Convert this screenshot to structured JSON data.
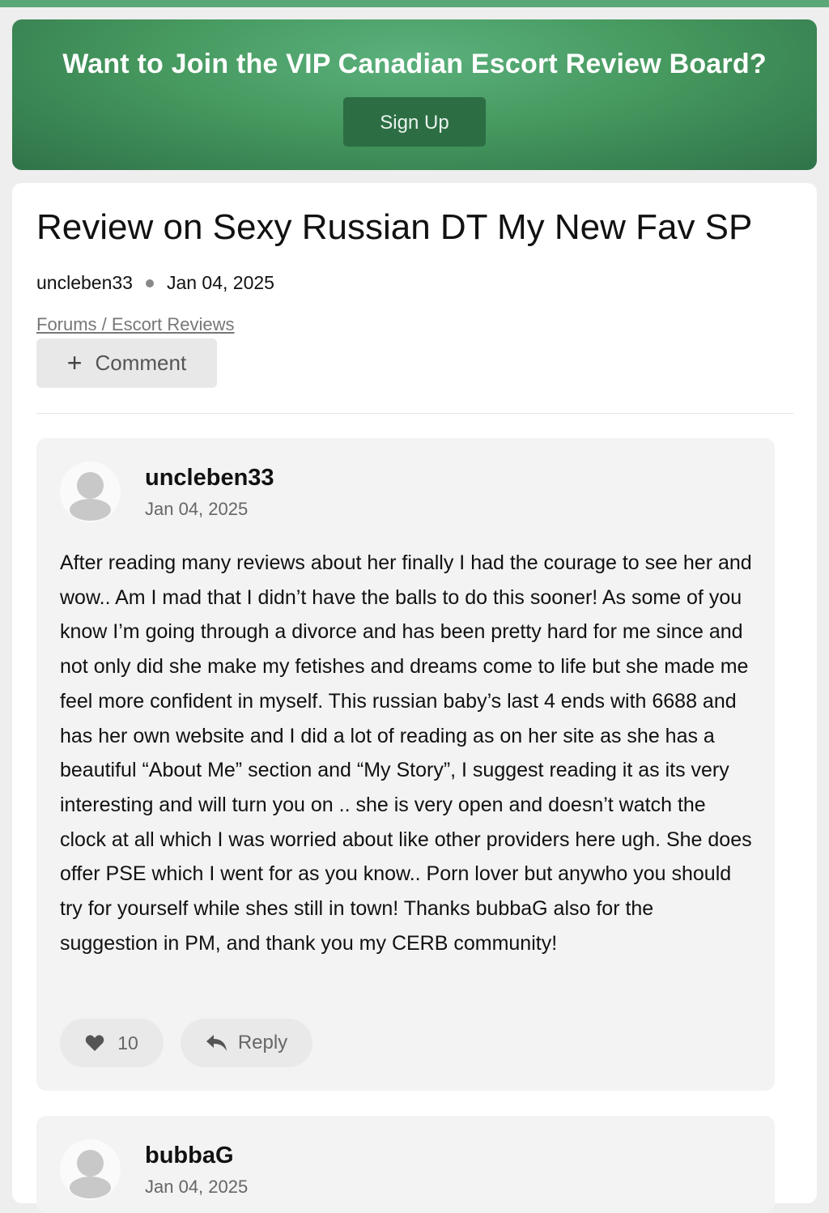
{
  "banner": {
    "title": "Want to Join the VIP Canadian Escort Review Board?",
    "signup_label": "Sign Up",
    "colors": {
      "start": "#5bb07c",
      "end": "#2f7349",
      "button": "#2c6d44"
    }
  },
  "thread": {
    "title": "Review on Sexy Russian DT My New Fav SP",
    "author": "uncleben33",
    "date": "Jan 04, 2025",
    "breadcrumb": "Forums / Escort Reviews",
    "comment_label": "Comment"
  },
  "posts": [
    {
      "username": "uncleben33",
      "date": "Jan 04, 2025",
      "body": "After reading many reviews about her finally I had the courage to see her and wow.. Am I mad that I didn’t have the balls to do this sooner! As some of you know I’m going through a divorce and has been pretty hard for me since and not only did she make my fetishes and dreams come to life but she made me feel more confident in myself. This russian baby’s last 4 ends with 6688 and has her own website and I did a lot of reading as on her site as she has a beautiful “About Me” section and “My Story”, I suggest reading it as its very interesting and will turn you on .. she is very open and doesn’t watch the clock at all which I was worried about like other providers here ugh. She does offer PSE which I went for as you know.. Porn lover but anywho you should try for yourself while shes still in town! Thanks bubbaG also for the suggestion in PM, and thank you my CERB community!",
      "likes": "10",
      "reply_label": "Reply"
    },
    {
      "username": "bubbaG",
      "date": "Jan 04, 2025"
    }
  ]
}
